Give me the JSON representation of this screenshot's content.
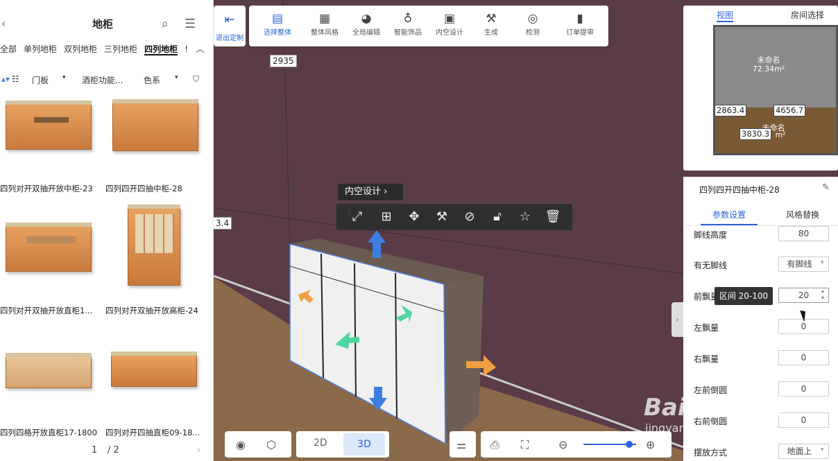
{
  "left_panel": {
    "title": "地柜",
    "categories": [
      "全部",
      "单列地柜",
      "双列地柜",
      "三列地柜",
      "四列地柜",
      "!"
    ],
    "filters": [
      "门板",
      "酒柜功能...",
      "色系"
    ],
    "items": [
      {
        "name": "四列对开双抽开放中柜-23"
      },
      {
        "name": "四列四开四抽中柜-28"
      },
      {
        "name": "四列对开双抽开放直柜1..."
      },
      {
        "name": "四列对开双抽开放高柜-24"
      },
      {
        "name": "四列四格开放直柜17-1800"
      },
      {
        "name": "四列对开四抽直柜09-18..."
      }
    ],
    "page_current": "1",
    "page_total": "/ 2"
  },
  "exit": {
    "label": "退出定制"
  },
  "toolbar": [
    {
      "label": "选择整体",
      "icon": "select-icon",
      "active": true
    },
    {
      "label": "整体风格",
      "icon": "brush-icon",
      "active": false
    },
    {
      "label": "全局编辑",
      "icon": "palette-icon",
      "active": false
    },
    {
      "label": "智能饰品",
      "icon": "bulb-icon",
      "active": false
    },
    {
      "label": "内空设计",
      "icon": "frame-icon",
      "active": false
    },
    {
      "label": "生成",
      "icon": "hammer-icon",
      "active": false
    },
    {
      "label": "检测",
      "icon": "target-icon",
      "active": false
    },
    {
      "label": "订单提审",
      "icon": "clipboard-icon",
      "active": false
    }
  ],
  "scene": {
    "dim_top": "2935",
    "dim_left": "3.4",
    "context_label": "内空设计",
    "context_tools": [
      "scale-icon",
      "duplicate-icon",
      "move-icon",
      "hammer-icon",
      "hide-icon",
      "lock-icon",
      "star-icon",
      "delete-icon"
    ]
  },
  "map": {
    "tab_view": "视图",
    "tab_room": "房间选择",
    "room1_name": "未命名",
    "room1_area": "72.34m²",
    "room2_name": "未命名",
    "room2_area": "m²",
    "dim_a": "2863.4",
    "dim_b": "4656.7",
    "dim_c": "3830.3"
  },
  "props": {
    "title": "四列四开四抽中柜-28",
    "tab_params": "参数设置",
    "tab_style": "风格替换",
    "rows": [
      {
        "label": "脚线高度",
        "value": "80"
      },
      {
        "label": "有无脚线",
        "value": "有脚线"
      },
      {
        "label": "前飘量",
        "value": "20"
      },
      {
        "label": "左飘量",
        "value": "0"
      },
      {
        "label": "右飘量",
        "value": "0"
      },
      {
        "label": "左前倒圆",
        "value": "0"
      },
      {
        "label": "右前倒圆",
        "value": "0"
      },
      {
        "label": "摆放方式",
        "value": "地面上"
      }
    ],
    "tooltip": "区间 20-100"
  },
  "bottom": {
    "view_2d": "2D",
    "view_3d": "3D",
    "zoom_level": 0.87
  },
  "watermark": {
    "brand": "Bai du 经验",
    "url": "jingyan.baidu.com"
  },
  "colors": {
    "accent": "#2b63d9",
    "wall": "#5a3c48"
  }
}
